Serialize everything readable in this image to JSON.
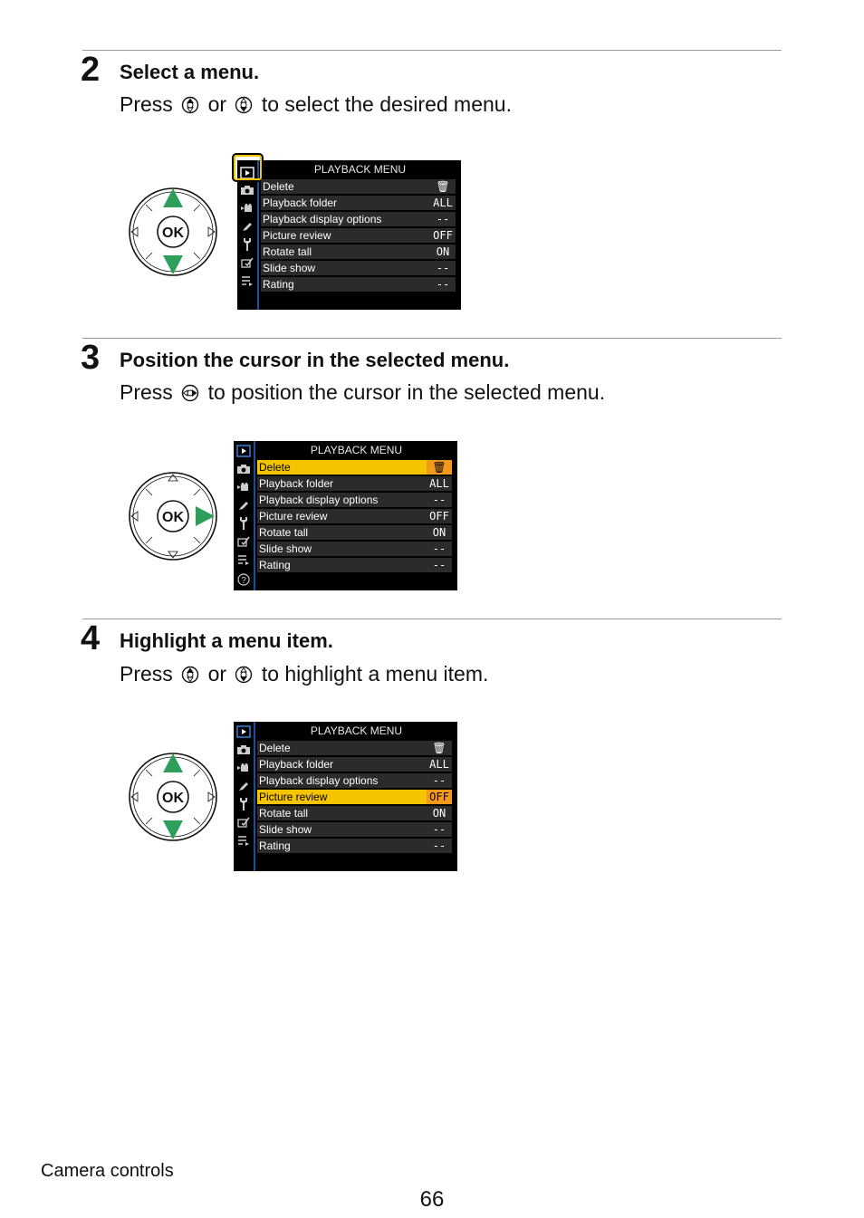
{
  "steps": [
    {
      "number": "2",
      "title": "Select a menu.",
      "text_before": "Press",
      "or": "or",
      "text_after": "to select the desired menu."
    },
    {
      "number": "3",
      "title": "Position the cursor in the selected menu.",
      "text_before": "Press",
      "text_after": "to position the cursor in the selected menu."
    },
    {
      "number": "4",
      "title": "Highlight a menu item.",
      "text_before": "Press",
      "or": "or",
      "text_after": "to highlight a menu item."
    }
  ],
  "menu": {
    "title": "PLAYBACK MENU",
    "items": [
      {
        "label": "Delete",
        "value": "🗑"
      },
      {
        "label": "Playback folder",
        "value": "ALL"
      },
      {
        "label": "Playback display options",
        "value": "--"
      },
      {
        "label": "Picture review",
        "value": "OFF"
      },
      {
        "label": "Rotate tall",
        "value": "ON"
      },
      {
        "label": "Slide show",
        "value": "--"
      },
      {
        "label": "Rating",
        "value": "--"
      }
    ]
  },
  "dial_label": "OK",
  "footer": {
    "section": "Camera controls",
    "page": "66"
  },
  "colors": {
    "highlight": "#f4c400",
    "value_highlight": "#f39a1d",
    "arrow": "#2e9e5b",
    "rule": "#9a9a9a",
    "sidebar_line": "#1e4f9a"
  }
}
